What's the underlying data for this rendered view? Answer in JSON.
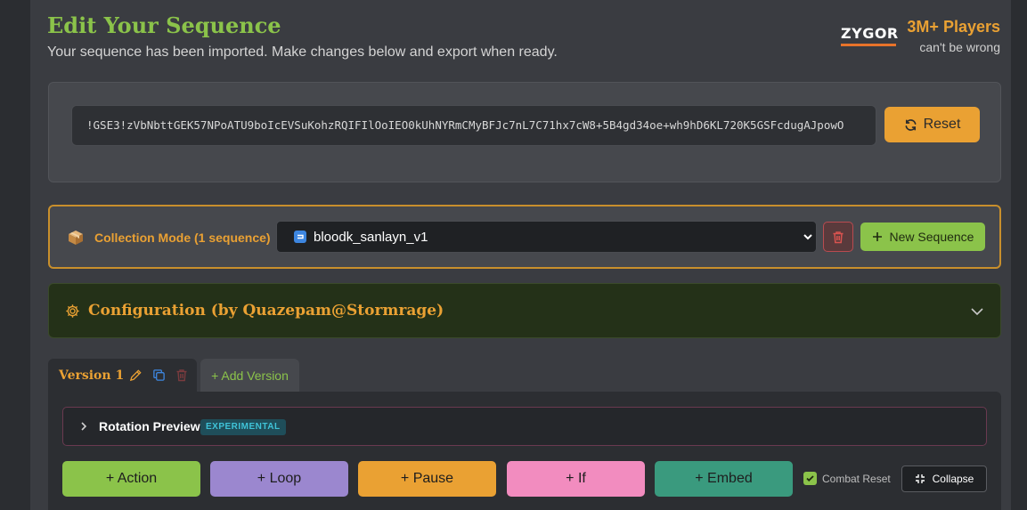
{
  "header": {
    "title": "Edit Your Sequence",
    "subtitle": "Your sequence has been imported. Make changes below and export when ready."
  },
  "brand": {
    "logo_text": "ZYGOR",
    "players": "3M+ Players",
    "tagline": "can't be wrong"
  },
  "import": {
    "value": "!GSE3!zVbNbttGEK57NPoATU9boIcEVSuKohzRQIFIlOoIEO0kUhNYRmCMyBFJc7nL7C71hx7cW8+5B4gd34oe+wh9hD6KL720K5GSFcdugAJpowO",
    "reset_label": "Reset"
  },
  "collection": {
    "label": "Collection Mode (1 sequence)",
    "selected": "bloodk_sanlayn_v1",
    "new_label": "New Sequence"
  },
  "config": {
    "title": "Configuration  (by Quazepam@Stormrage)"
  },
  "versions": {
    "active_label": "Version 1",
    "add_label": "+ Add Version"
  },
  "preview": {
    "label": "Rotation Preview",
    "badge": "EXPERIMENTAL"
  },
  "actions": {
    "items": [
      {
        "label": "+ Action",
        "color": "#8bc34a"
      },
      {
        "label": "+ Loop",
        "color": "#9b87cf"
      },
      {
        "label": "+ Pause",
        "color": "#eaa133"
      },
      {
        "label": "+ If",
        "color": "#f28cbf"
      },
      {
        "label": "+ Embed",
        "color": "#3a9a7e"
      }
    ],
    "combat_reset": "Combat Reset",
    "collapse_label": "Collapse"
  },
  "colors": {
    "accent_green": "#8bc34a",
    "accent_orange": "#eaa133",
    "brand_orange": "#e8732a"
  }
}
